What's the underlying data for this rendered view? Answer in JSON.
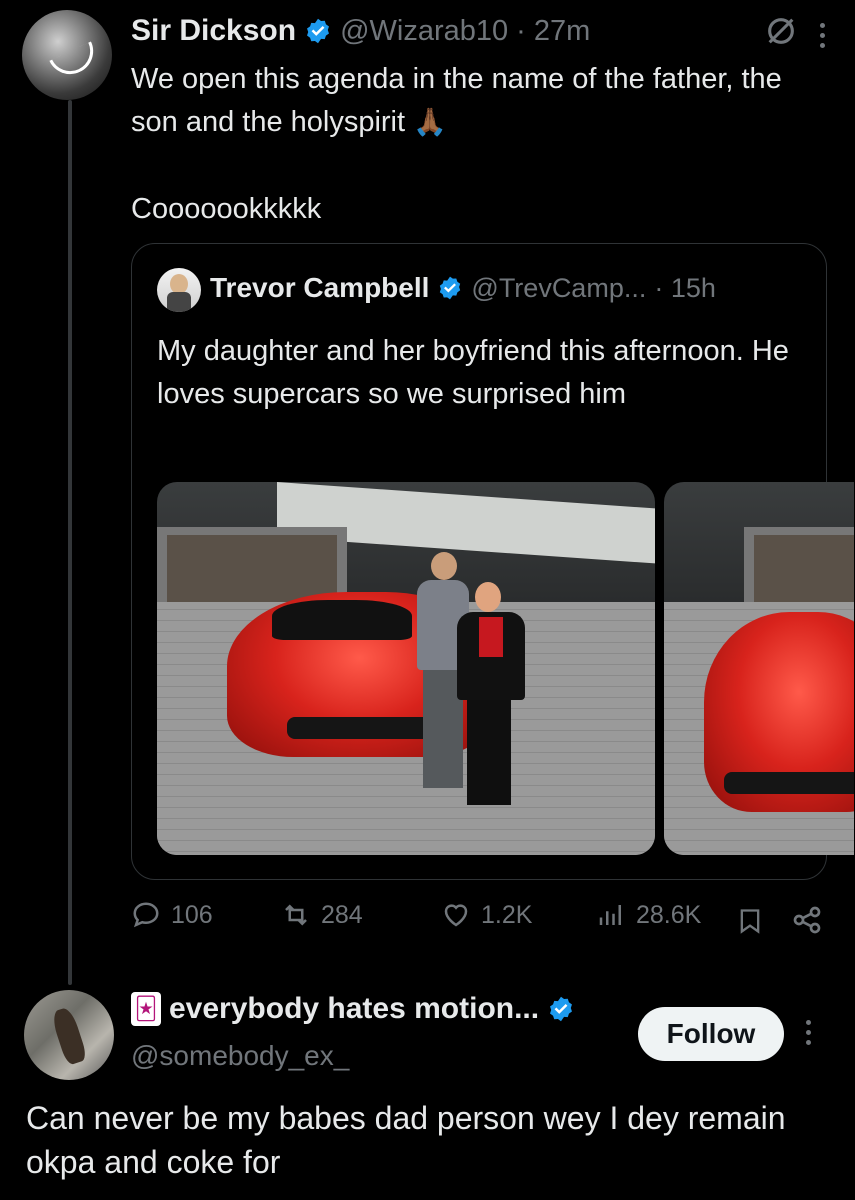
{
  "colors": {
    "background": "#000000",
    "text": "#e7e9ea",
    "muted": "#71767b",
    "verified": "#1d9bf0"
  },
  "main_tweet": {
    "author_name": "Sir Dickson",
    "handle_time": "@Wizarab10 · 27m",
    "text_line": "We open this agenda in the name of the father, the son and the holyspirit",
    "pray_emoji": "🙏🏾",
    "text_second": "Cooooookkkkk",
    "grok_icon": "grok-icon",
    "quote": {
      "author_name": "Trevor Campbell",
      "handle": "@TrevCamp...",
      "time": "· 15h",
      "text": "My daughter and her boyfriend this afternoon. He loves supercars so we surprised him"
    },
    "stats": {
      "replies": "106",
      "reposts": "284",
      "likes": "1.2K",
      "views": "28.6K"
    }
  },
  "reply": {
    "author_name": "everybody hates motion...",
    "name_emoji": "🃏",
    "handle": "@somebody_ex_",
    "follow_label": "Follow",
    "text": "Can never be my babes dad person wey I dey remain okpa and coke for"
  }
}
